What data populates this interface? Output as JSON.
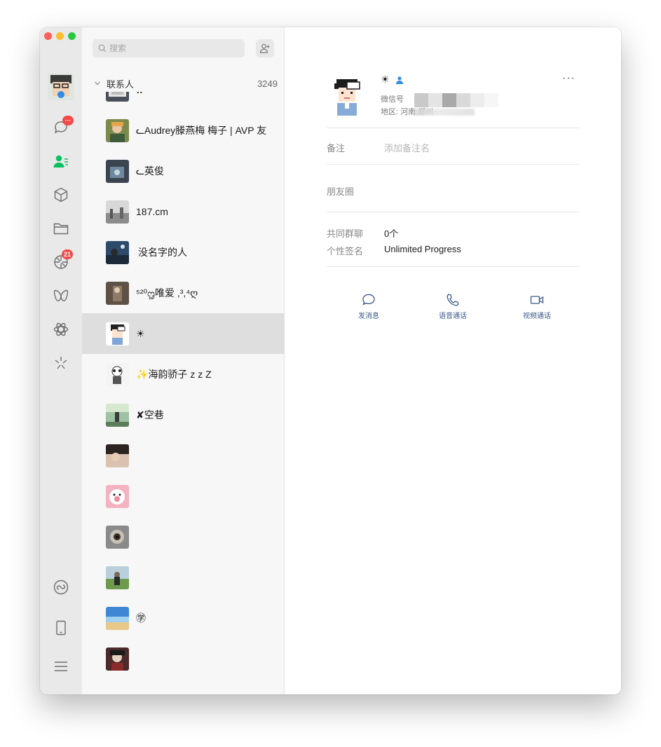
{
  "search": {
    "placeholder": "搜索"
  },
  "rail": {
    "chat_badge": "···",
    "moments_badge": "21"
  },
  "list": {
    "group_label": "联系人",
    "group_count": "3249",
    "contacts": [
      {
        "name": "w"
      },
      {
        "name": "ᓚAudrey滕燕梅 梅子 | AVP 友"
      },
      {
        "name": "ᓚ英俊"
      },
      {
        "name": "187.cm"
      },
      {
        "name": "没名字的人"
      },
      {
        "name": "⁵²⁰ᦗ唯爱 ,³,⁴ღ"
      },
      {
        "name": "☀"
      },
      {
        "name": "✨海韵骄子 z z Z"
      },
      {
        "name": "✘空巷"
      },
      {
        "name": ""
      },
      {
        "name": ""
      },
      {
        "name": ""
      },
      {
        "name": ""
      },
      {
        "name": "㊫"
      },
      {
        "name": ""
      }
    ]
  },
  "profile": {
    "name": "☀",
    "wechat_id_label": "微信号",
    "region_label": "地区: 河南 郑州",
    "more": "···"
  },
  "fields": {
    "remark_label": "备注",
    "remark_placeholder": "添加备注名",
    "moments_label": "朋友圈",
    "groups_label": "共同群聊",
    "groups_value": "0个",
    "signature_label": "个性签名",
    "signature_value": "Unlimited Progress"
  },
  "actions": {
    "message": "发消息",
    "voice": "语音通话",
    "video": "视频通话"
  },
  "colors": {
    "accent_green": "#07c160",
    "badge_red": "#f24a4a",
    "link_blue": "#3b5a8a"
  }
}
